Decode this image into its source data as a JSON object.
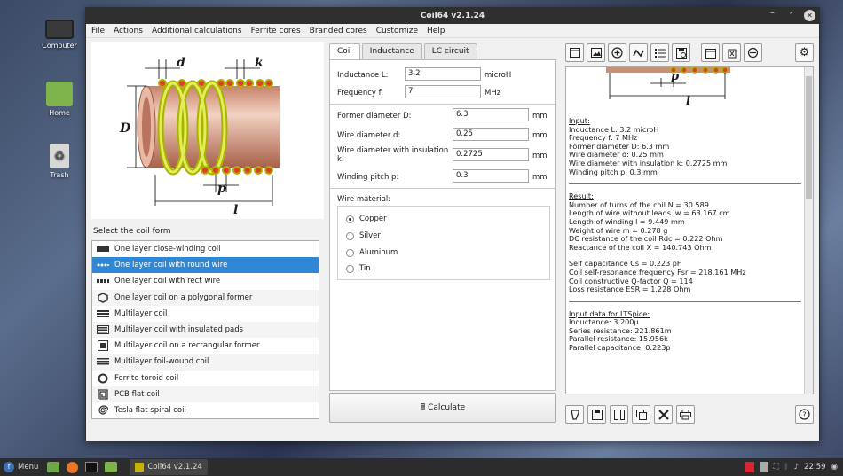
{
  "desktop": {
    "icons": [
      "Computer",
      "Home",
      "Trash"
    ]
  },
  "window": {
    "title": "Coil64 v2.1.24"
  },
  "menu": [
    "File",
    "Actions",
    "Additional calculations",
    "Ferrite cores",
    "Branded cores",
    "Customize",
    "Help"
  ],
  "diagram": {
    "d": "d",
    "k": "k",
    "D": "D",
    "p": "p",
    "l": "l"
  },
  "coil_forms": {
    "label": "Select the coil form",
    "items": [
      "One layer close-winding coil",
      "One layer coil with round wire",
      "One layer coil with rect wire",
      "One layer coil on a polygonal former",
      "Multilayer coil",
      "Multilayer coil with insulated pads",
      "Multilayer coil on a rectangular former",
      "Multilayer foil-wound coil",
      "Ferrite toroid coil",
      "PCB flat coil",
      "Tesla flat spiral coil"
    ],
    "selected_index": 1
  },
  "tabs": [
    "Coil",
    "Inductance",
    "LC circuit"
  ],
  "inputs": {
    "inductance": {
      "label": "Inductance L:",
      "value": "3.2",
      "unit": "microH"
    },
    "frequency": {
      "label": "Frequency f:",
      "value": "7",
      "unit": "MHz"
    },
    "former": {
      "label": "Former diameter D:",
      "value": "6.3",
      "unit": "mm"
    },
    "wire": {
      "label": "Wire diameter d:",
      "value": "0.25",
      "unit": "mm"
    },
    "wire_ins": {
      "label": "Wire diameter with insulation k:",
      "value": "0.2725",
      "unit": "mm"
    },
    "pitch": {
      "label": "Winding pitch p:",
      "value": "0.3",
      "unit": "mm"
    }
  },
  "material": {
    "label": "Wire material:",
    "options": [
      "Copper",
      "Silver",
      "Aluminum",
      "Tin"
    ],
    "selected": "Copper"
  },
  "calculate_label": "Calculate",
  "results": {
    "input_header": "Input:",
    "input_lines": [
      "Inductance L: 3.2 microH",
      "Frequency f: 7 MHz",
      "Former diameter D: 6.3 mm",
      "Wire diameter d: 0.25 mm",
      "Wire diameter with insulation k: 0.2725 mm",
      "Winding pitch p: 0.3 mm"
    ],
    "result_header": "Result:",
    "result_lines": [
      "Number of turns of the coil N = 30.589",
      "Length of wire without leads lw = 63.167 cm",
      "Length of winding l = 9.449 mm",
      "Weight of wire m = 0.278 g",
      "DC resistance of the coil Rdc = 0.222 Ohm",
      "Reactance of the coil X = 140.743 Ohm"
    ],
    "result_lines2": [
      "Self capacitance Cs = 0.223 pF",
      "Coil self-resonance frequency Fsr = 218.161 MHz",
      "Coil constructive Q-factor Q = 114",
      "Loss resistance ESR = 1.228 Ohm"
    ],
    "ltspice_header": "Input data for LTSpice:",
    "ltspice_lines": [
      "Inductance: 3.200µ",
      "Series resistance: 221.861m",
      "Parallel resistance: 15.956k",
      "Parallel capacitance: 0.223p"
    ]
  },
  "taskbar": {
    "menu_label": "Menu",
    "app_label": "Coil64 v2.1.24",
    "clock": "22:59"
  }
}
